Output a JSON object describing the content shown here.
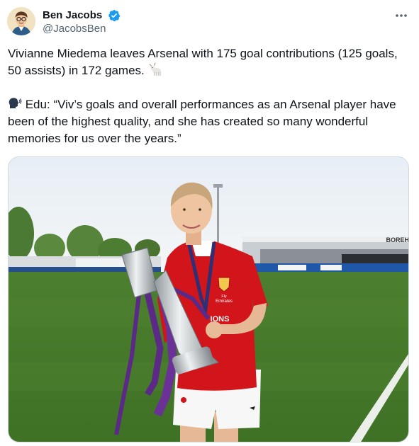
{
  "author": {
    "display_name": "Ben Jacobs",
    "handle": "@JacobsBen",
    "verified": true,
    "verified_color": "#1d9bf0"
  },
  "tweet": {
    "paragraph_1": "Vivianne Miedema leaves Arsenal with 175 goal contributions (125 goals, 50 assists) in 172 games.",
    "paragraph_1_emoji": "goat-emoji",
    "paragraph_2_emoji": "speaking-head-emoji",
    "paragraph_2": " Edu: “Viv’s goals and overall performances as an Arsenal player have been of the highest quality, and she has created so many wonderful memories for us over the years.”"
  },
  "media": {
    "description_icon": "photo",
    "stadium_sign": "BOREH",
    "shirt_sponsor_top": "Fly",
    "shirt_sponsor": "Emirates",
    "shirt_text": "IONS"
  },
  "colors": {
    "text": "#0f1419",
    "secondary": "#536471",
    "border": "#cfd9de",
    "arsenal_red": "#d2151b",
    "ribbon_purple": "#5b2a86"
  }
}
